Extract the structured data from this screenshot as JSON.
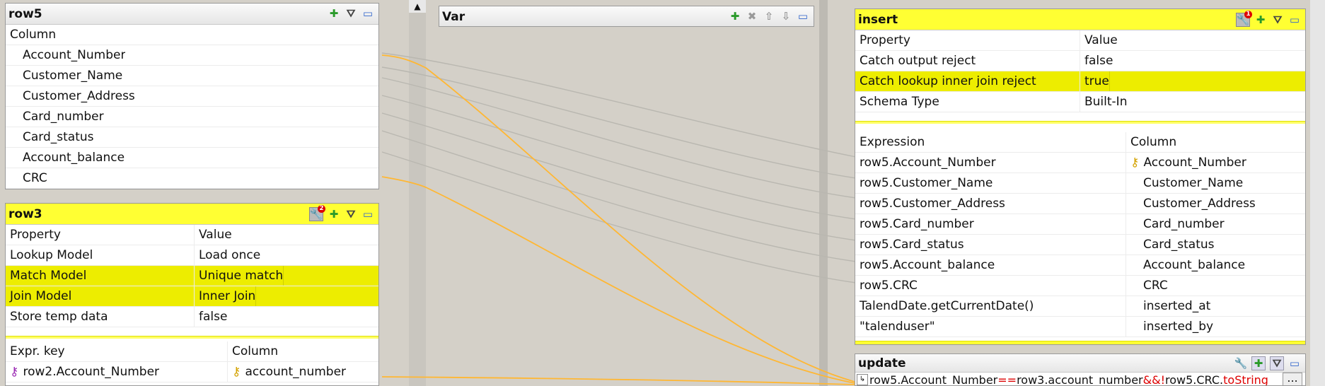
{
  "row5": {
    "title": "row5",
    "column_header": "Column",
    "columns": [
      "Account_Number",
      "Customer_Name",
      "Customer_Address",
      "Card_number",
      "Card_status",
      "Account_balance",
      "CRC"
    ]
  },
  "row3": {
    "title": "row3",
    "badge": "2",
    "prop_header": "Property",
    "value_header": "Value",
    "props": [
      {
        "p": "Lookup Model",
        "v": "Load once"
      },
      {
        "p": "Match Model",
        "v": "Unique match"
      },
      {
        "p": "Join Model",
        "v": "Inner Join"
      },
      {
        "p": "Store temp data",
        "v": "false"
      }
    ],
    "expr_header": "Expr. key",
    "col_header": "Column",
    "keys": [
      {
        "e": "row2.Account_Number",
        "c": "account_number"
      }
    ]
  },
  "var": {
    "title": "Var"
  },
  "insert": {
    "title": "insert",
    "badge": "1",
    "prop_header": "Property",
    "value_header": "Value",
    "props": [
      {
        "p": "Catch output reject",
        "v": "false"
      },
      {
        "p": "Catch lookup inner join reject",
        "v": "true"
      },
      {
        "p": "Schema Type",
        "v": "Built-In"
      }
    ],
    "expr_header": "Expression",
    "col_header": "Column",
    "mappings": [
      {
        "e": "row5.Account_Number",
        "c": "Account_Number"
      },
      {
        "e": "row5.Customer_Name",
        "c": "Customer_Name"
      },
      {
        "e": "row5.Customer_Address",
        "c": "Customer_Address"
      },
      {
        "e": "row5.Card_number",
        "c": "Card_number"
      },
      {
        "e": "row5.Card_status",
        "c": "Card_status"
      },
      {
        "e": "row5.Account_balance",
        "c": "Account_balance"
      },
      {
        "e": "row5.CRC",
        "c": "CRC"
      },
      {
        "e": "TalendDate.getCurrentDate()",
        "c": "inserted_at"
      },
      {
        "e": "\"talenduser\"",
        "c": "inserted_by"
      }
    ]
  },
  "update": {
    "title": "update",
    "filter_prefix": "row5.Account_Number",
    "filter_op1": "==",
    "filter_mid": "row3.account_number",
    "filter_op2": "&&!",
    "filter_tail": "row5.CRC.",
    "filter_method": "toString",
    "more": "..."
  },
  "colors": {
    "header_yellow": "#ffff33",
    "highlight": "#eded00",
    "link": "#ffb733",
    "link_gray": "#b9b7b0"
  }
}
